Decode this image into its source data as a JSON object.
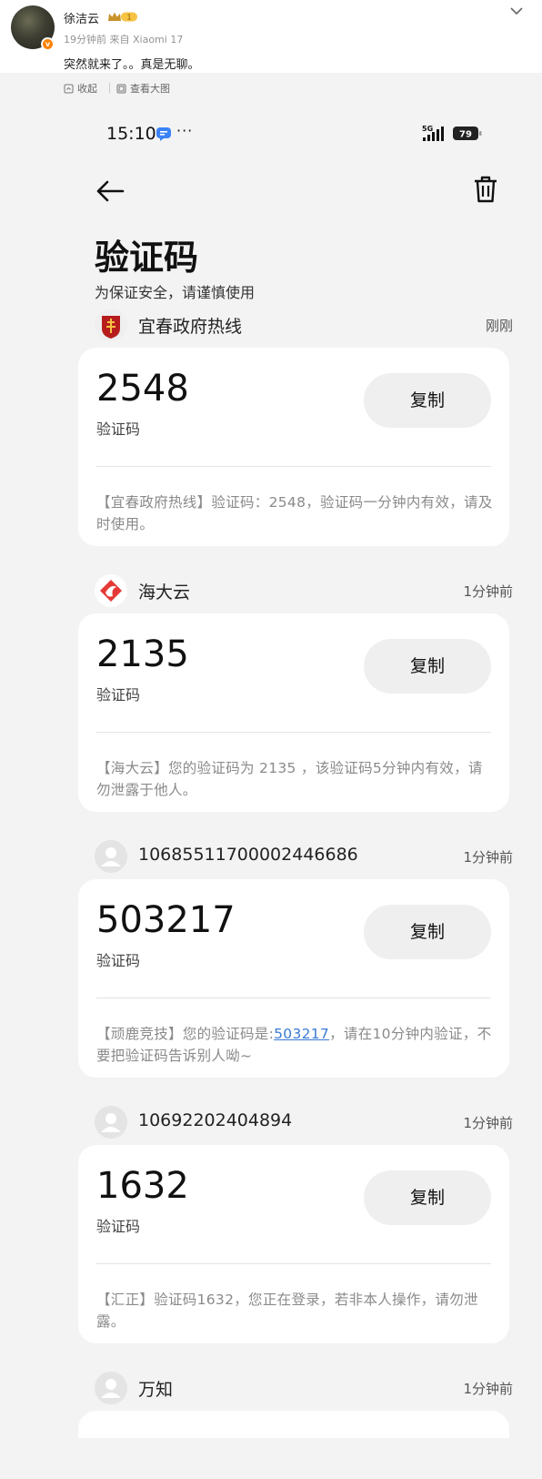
{
  "post": {
    "username": "徐洁云",
    "time": "19分钟前",
    "source": "来自 Xiaomi 17",
    "text": "突然就来了。。真是无聊。",
    "badge": "v",
    "toolbar": {
      "collect": "收起",
      "view_large": "查看大图"
    }
  },
  "status_bar": {
    "time": "15:10",
    "dots": "···",
    "network": "5G",
    "battery": "79"
  },
  "page": {
    "title": "验证码",
    "subtitle": "为保证安全，请谨慎使用"
  },
  "messages": [
    {
      "sender": "宜春政府热线",
      "time": "刚刚",
      "code": "2548",
      "code_label": "验证码",
      "copy_label": "复制",
      "body": "【宜春政府热线】验证码：2548，验证码一分钟内有效，请及时使用。"
    },
    {
      "sender": "海大云",
      "time": "1分钟前",
      "code": "2135",
      "code_label": "验证码",
      "copy_label": "复制",
      "body": "【海大云】您的验证码为 2135 ，该验证码5分钟内有效，请勿泄露于他人。"
    },
    {
      "sender": "10685511700002446686",
      "time": "1分钟前",
      "code": "503217",
      "code_label": "验证码",
      "copy_label": "复制",
      "body_pre": "【顽鹿竞技】您的验证码是:",
      "body_link": "503217",
      "body_post": "，请在10分钟内验证，不要把验证码告诉别人呦~"
    },
    {
      "sender": "10692202404894",
      "time": "1分钟前",
      "code": "1632",
      "code_label": "验证码",
      "copy_label": "复制",
      "body": "【汇正】验证码1632，您正在登录，若非本人操作，请勿泄露。"
    },
    {
      "sender": "万知",
      "time": "1分钟前"
    }
  ],
  "colors": {
    "link": "#3a7bd5",
    "weibo_orange": "#ff8200",
    "card_bg": "#ffffff",
    "screen_bg": "#f3f3f3"
  }
}
